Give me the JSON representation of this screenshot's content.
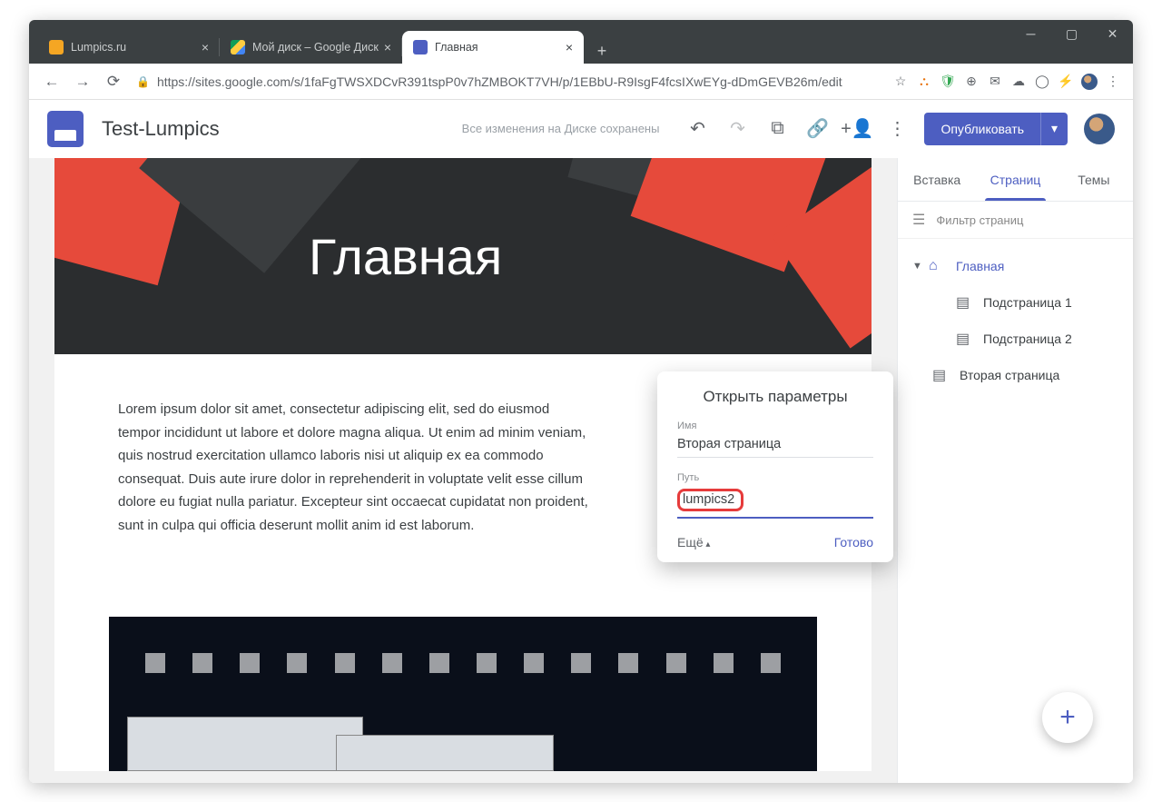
{
  "browser": {
    "tabs": [
      {
        "title": "Lumpics.ru"
      },
      {
        "title": "Мой диск – Google Диск"
      },
      {
        "title": "Главная"
      }
    ],
    "url": "https://sites.google.com/s/1faFgTWSXDCvR391tspP0v7hZMBOKT7VH/p/1EBbU-R9IsgF4fcsIXwEYg-dDmGEVB26m/edit"
  },
  "app": {
    "site_name": "Test-Lumpics",
    "save_status": "Все изменения на Диске сохранены",
    "publish": "Опубликовать"
  },
  "hero_title": "Главная",
  "lorem": "Lorem ipsum dolor sit amet, consectetur adipiscing elit, sed do eiusmod tempor incididunt ut labore et dolore magna aliqua. Ut enim ad minim veniam, quis nostrud exercitation ullamco laboris nisi ut aliquip ex ea commodo consequat. Duis aute irure dolor in reprehenderit in voluptate velit esse cillum dolore eu fugiat nulla pariatur. Excepteur sint occaecat cupidatat non proident, sunt in culpa qui officia deserunt mollit anim id est laborum.",
  "side": {
    "tab_insert": "Вставка",
    "tab_pages": "Страниц",
    "tab_themes": "Темы",
    "filter_placeholder": "Фильтр страниц",
    "pages": {
      "home": "Главная",
      "sub1": "Подстраница 1",
      "sub2": "Подстраница 2",
      "second": "Вторая страница"
    }
  },
  "popup": {
    "title": "Открыть параметры",
    "name_label": "Имя",
    "name_value": "Вторая страница",
    "path_label": "Путь",
    "path_value": "lumpics2",
    "more": "Ещё",
    "done": "Готово"
  }
}
